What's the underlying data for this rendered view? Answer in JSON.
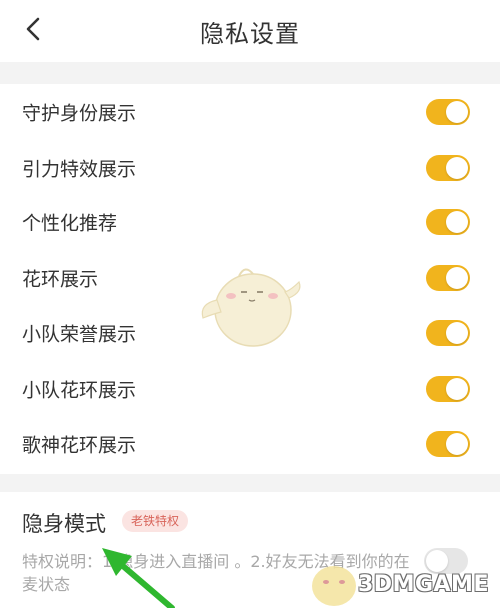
{
  "header": {
    "title": "隐私设置",
    "back_icon": "chevron-left-icon"
  },
  "settings": [
    {
      "label": "守护身份展示",
      "on": true
    },
    {
      "label": "引力特效展示",
      "on": true
    },
    {
      "label": "个性化推荐",
      "on": true
    },
    {
      "label": "花环展示",
      "on": true
    },
    {
      "label": "小队荣誉展示",
      "on": true
    },
    {
      "label": "小队花环展示",
      "on": true
    },
    {
      "label": "歌神花环展示",
      "on": true
    }
  ],
  "stealth": {
    "title": "隐身模式",
    "badge": "老铁特权",
    "description": "特权说明：1.隐身进入直播间 。2.好友无法看到你的在麦状态",
    "on": false
  },
  "watermark": {
    "text": "3DMGAME"
  },
  "colors": {
    "toggle_on": "#f1b41d",
    "toggle_off": "#e6e6e6",
    "arrow": "#2fb72f",
    "badge_text": "#d8645a"
  }
}
